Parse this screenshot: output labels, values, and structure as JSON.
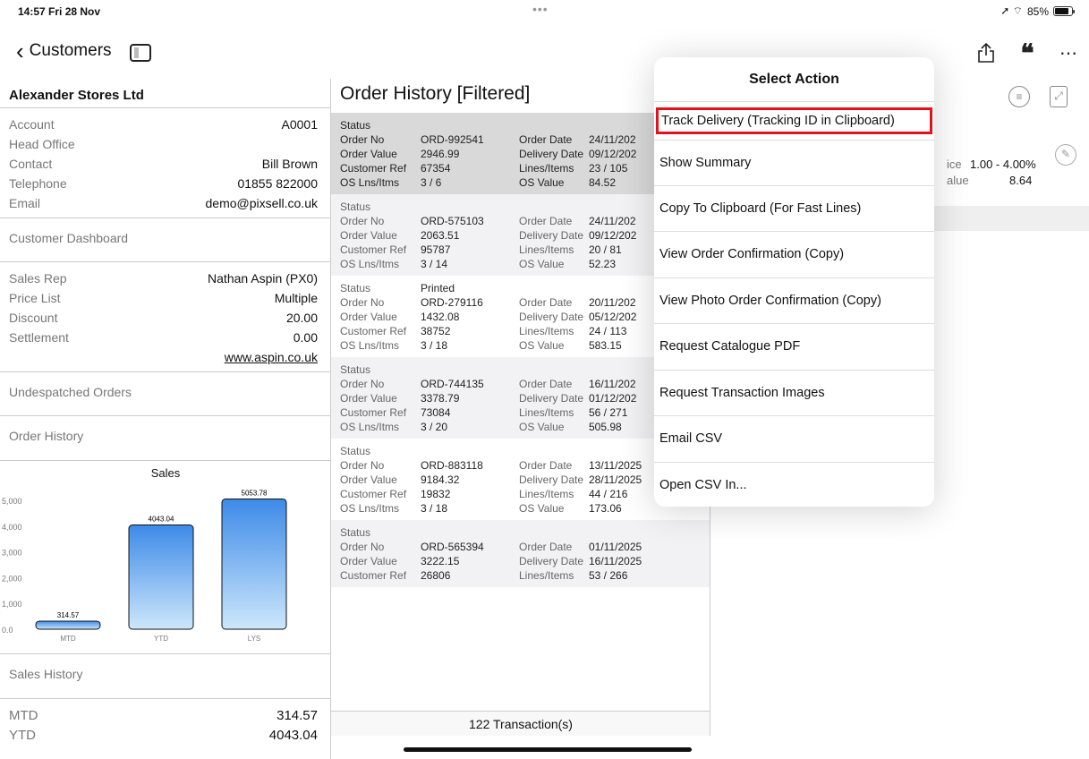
{
  "status_bar": {
    "time": "14:57  Fri 28 Nov",
    "dots": "•••",
    "signal": "➚ ⌔",
    "battery": "85%"
  },
  "nav": {
    "back_label": "Customers"
  },
  "customer": {
    "name": "Alexander Stores Ltd",
    "info": [
      {
        "k": "Account",
        "v": "A0001"
      },
      {
        "k": "Head Office",
        "v": ""
      },
      {
        "k": "Contact",
        "v": "Bill Brown"
      },
      {
        "k": "Telephone",
        "v": "01855 822000"
      },
      {
        "k": "Email",
        "v": "demo@pixsell.co.uk"
      }
    ],
    "dashboard_label": "Customer Dashboard",
    "terms": [
      {
        "k": "Sales Rep",
        "v": "Nathan Aspin (PX0)"
      },
      {
        "k": "Price List",
        "v": "Multiple"
      },
      {
        "k": "Discount",
        "v": "20.00"
      },
      {
        "k": "Settlement",
        "v": "0.00"
      }
    ],
    "website": "www.aspin.co.uk",
    "undespatched_label": "Undespatched Orders",
    "order_history_label": "Order History",
    "sales_history_label": "Sales History",
    "sales_rows": [
      {
        "k": "MTD",
        "v": "314.57"
      },
      {
        "k": "YTD",
        "v": "4043.04"
      }
    ]
  },
  "chart_data": {
    "type": "bar",
    "title": "Sales",
    "categories": [
      "MTD",
      "YTD",
      "LYS"
    ],
    "values": [
      314.57,
      4043.04,
      5053.78
    ],
    "value_labels": [
      "314.57",
      "4043.04",
      "5053.78"
    ],
    "ylim": [
      0,
      5000
    ],
    "yticks": [
      "0.0",
      "1,000",
      "2,000",
      "3,000",
      "4,000",
      "5,000"
    ],
    "colors": {
      "bar_top": "#3d8ae8",
      "bar_bottom": "#cde7fb"
    }
  },
  "orders_panel": {
    "title": "Order History [Filtered]",
    "footer": "122 Transaction(s)",
    "field_labels": {
      "status": "Status",
      "order_no": "Order No",
      "order_value": "Order Value",
      "customer_ref": "Customer Ref",
      "os": "OS Lns/Itms",
      "order_date": "Order Date",
      "delivery_date": "Delivery Date",
      "lines": "Lines/Items",
      "os_value": "OS Value"
    },
    "orders": [
      {
        "status": "",
        "order_no": "ORD-992541",
        "order_value": "2946.99",
        "customer_ref": "67354",
        "os": "3 / 6",
        "order_date": "24/11/202",
        "delivery_date": "09/12/202",
        "lines": "23 / 105",
        "os_value": "84.52"
      },
      {
        "status": "",
        "order_no": "ORD-575103",
        "order_value": "2063.51",
        "customer_ref": "95787",
        "os": "3 / 14",
        "order_date": "24/11/202",
        "delivery_date": "09/12/202",
        "lines": "20 / 81",
        "os_value": "52.23"
      },
      {
        "status": "Printed",
        "order_no": "ORD-279116",
        "order_value": "1432.08",
        "customer_ref": "38752",
        "os": "3 / 18",
        "order_date": "20/11/202",
        "delivery_date": "05/12/202",
        "lines": "24 / 113",
        "os_value": "583.15"
      },
      {
        "status": "",
        "order_no": "ORD-744135",
        "order_value": "3378.79",
        "customer_ref": "73084",
        "os": "3 / 20",
        "order_date": "16/11/202",
        "delivery_date": "01/12/202",
        "lines": "56 / 271",
        "os_value": "505.98"
      },
      {
        "status": "",
        "order_no": "ORD-883118",
        "order_value": "9184.32",
        "customer_ref": "19832",
        "os": "3 / 18",
        "order_date": "13/11/2025",
        "delivery_date": "28/11/2025",
        "lines": "44 / 216",
        "os_value": "173.06"
      },
      {
        "status": "",
        "order_no": "ORD-565394",
        "order_value": "3222.15",
        "customer_ref": "26806",
        "os": "",
        "order_date": "01/11/2025",
        "delivery_date": "16/11/2025",
        "lines": "53 / 266",
        "os_value": ""
      }
    ]
  },
  "detail": {
    "price_label": "ice",
    "price_value": "1.00 - 4.00%",
    "value_label": "alue",
    "value_value": "8.64"
  },
  "popover": {
    "title": "Select Action",
    "actions": [
      "Track Delivery (Tracking ID in Clipboard)",
      "Show Summary",
      "Copy To Clipboard (For Fast Lines)",
      "View Order Confirmation (Copy)",
      "View Photo Order Confirmation (Copy)",
      "Request Catalogue PDF",
      "Request Transaction Images",
      "Email CSV",
      "Open CSV In..."
    ]
  }
}
